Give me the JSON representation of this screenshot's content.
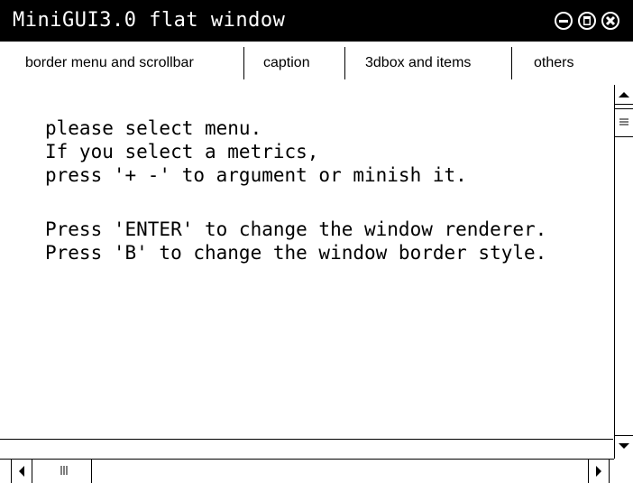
{
  "window": {
    "title": "MiniGUI3.0 flat window",
    "controls": {
      "minimize_icon": "minimize-icon",
      "maximize_icon": "maximize-icon",
      "close_icon": "close-icon"
    }
  },
  "menubar": {
    "items": [
      {
        "label": "border menu and scrollbar"
      },
      {
        "label": "caption"
      },
      {
        "label": "3dbox and items"
      },
      {
        "label": "others"
      }
    ]
  },
  "content": {
    "lines": [
      "please select menu.",
      "If you select a metrics,",
      "press '+ -' to argument or minish it.",
      "Press 'ENTER' to change the window renderer.",
      "Press 'B' to change the window border style."
    ]
  },
  "scrollbars": {
    "vertical": {
      "up_icon": "arrow-up-icon",
      "down_icon": "arrow-down-icon",
      "thumb_icon": "grip-lines-icon"
    },
    "horizontal": {
      "left_icon": "arrow-left-icon",
      "right_icon": "arrow-right-icon",
      "thumb_icon": "grip-lines-icon"
    }
  },
  "colors": {
    "titlebar_bg": "#000000",
    "titlebar_text": "#ffffff",
    "background": "#ffffff",
    "text": "#000000"
  }
}
